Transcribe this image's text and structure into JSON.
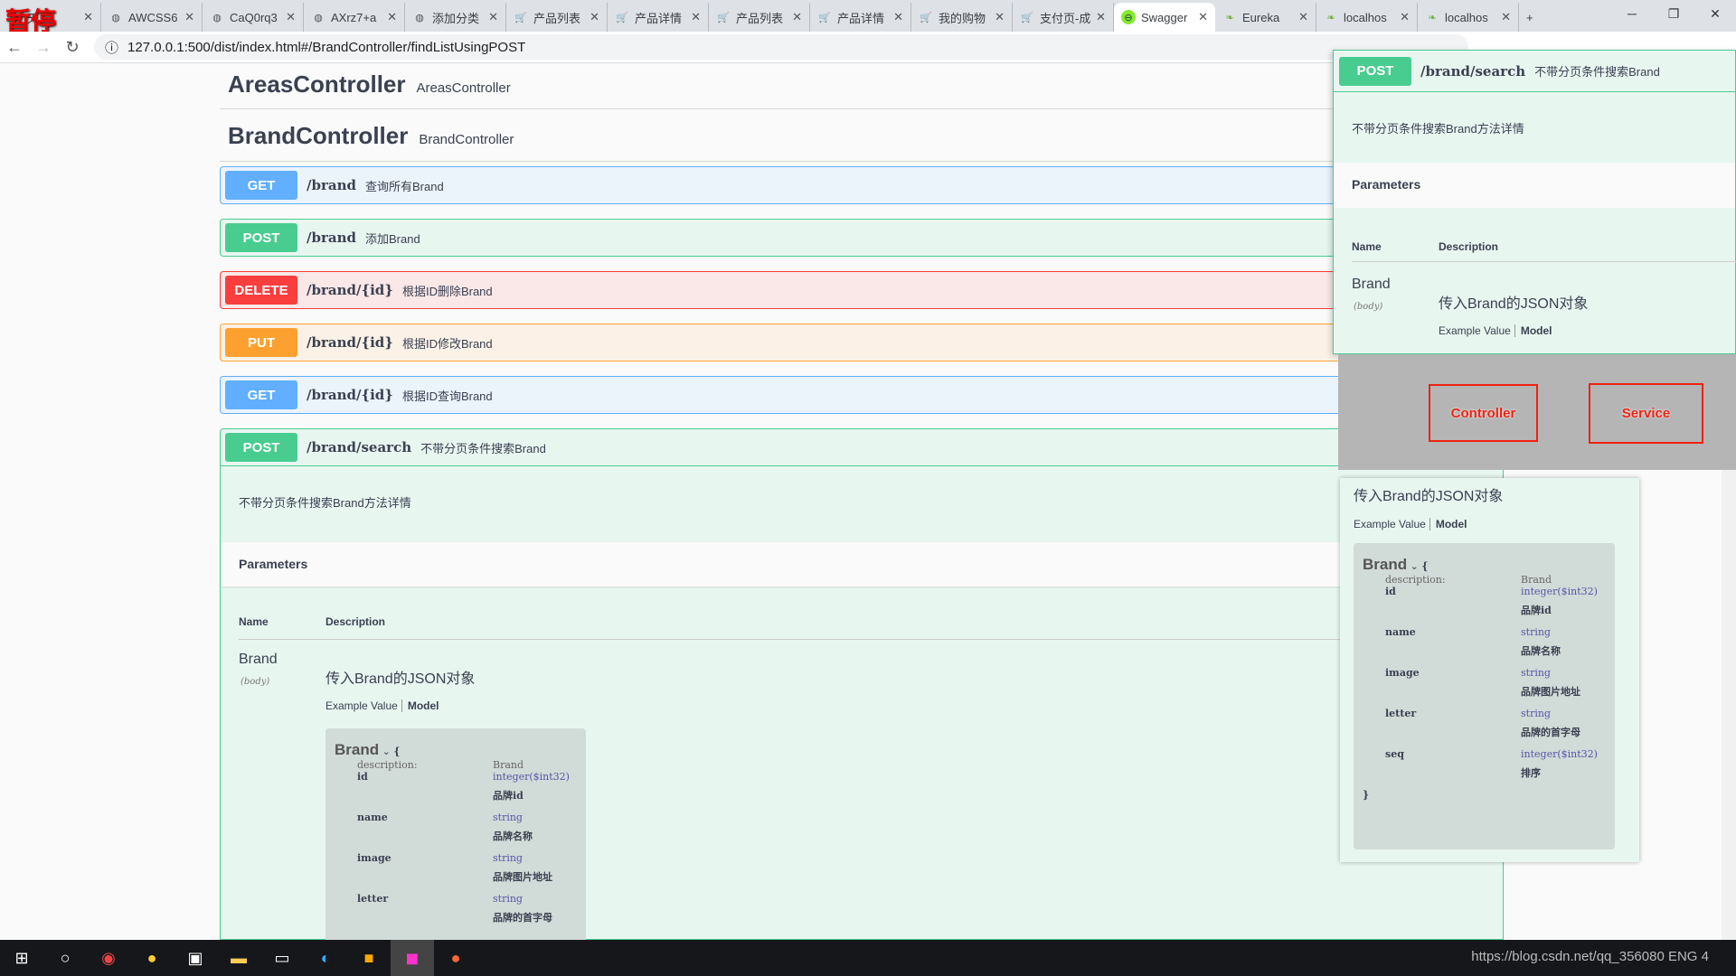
{
  "browser": {
    "overlay_label": "暂停",
    "tabs": [
      {
        "label": "天",
        "icon": "globe"
      },
      {
        "label": "AWCSS6",
        "icon": "globe"
      },
      {
        "label": "CaQ0rq3",
        "icon": "globe"
      },
      {
        "label": "AXrz7+a",
        "icon": "globe"
      },
      {
        "label": "添加分类",
        "icon": "globe"
      },
      {
        "label": "产品列表",
        "icon": "cart"
      },
      {
        "label": "产品详情",
        "icon": "cart"
      },
      {
        "label": "产品列表",
        "icon": "cart"
      },
      {
        "label": "产品详情",
        "icon": "cart"
      },
      {
        "label": "我的购物",
        "icon": "cart"
      },
      {
        "label": "支付页-成",
        "icon": "cart"
      },
      {
        "label": "Swagger",
        "icon": "swagger",
        "active": true
      },
      {
        "label": "Eureka",
        "icon": "spring"
      },
      {
        "label": "localhos",
        "icon": "spring"
      },
      {
        "label": "localhos",
        "icon": "spring"
      }
    ],
    "url": "127.0.0.1:500/dist/index.html#/BrandController/findListUsingPOST"
  },
  "swagger": {
    "tags": [
      {
        "name": "AreasController",
        "desc": "AreasController"
      },
      {
        "name": "BrandController",
        "desc": "BrandController"
      }
    ],
    "operations": [
      {
        "method": "GET",
        "path": "/brand",
        "summary": "查询所有Brand"
      },
      {
        "method": "POST",
        "path": "/brand",
        "summary": "添加Brand"
      },
      {
        "method": "DELETE",
        "path": "/brand/{id}",
        "summary": "根据ID删除Brand"
      },
      {
        "method": "PUT",
        "path": "/brand/{id}",
        "summary": "根据ID修改Brand"
      },
      {
        "method": "GET",
        "path": "/brand/{id}",
        "summary": "根据ID查询Brand"
      },
      {
        "method": "POST",
        "path": "/brand/search",
        "summary": "不带分页条件搜索Brand"
      }
    ],
    "expanded": {
      "description": "不带分页条件搜索Brand方法详情",
      "parameters_title": "Parameters",
      "col_name": "Name",
      "col_desc": "Description",
      "param_name": "Brand",
      "param_in": "(body)",
      "param_desc": "传入Brand的JSON对象",
      "example_value": "Example Value",
      "model": "Model",
      "model_name": "Brand",
      "open_brace": "{",
      "close_brace": "}",
      "model_desc_label": "description:",
      "model_desc": "Brand",
      "fields": [
        {
          "name": "id",
          "type": "integer($int32)",
          "desc": "品牌id"
        },
        {
          "name": "name",
          "type": "string",
          "desc": "品牌名称"
        },
        {
          "name": "image",
          "type": "string",
          "desc": "品牌图片地址"
        },
        {
          "name": "letter",
          "type": "string",
          "desc": "品牌的首字母"
        },
        {
          "name": "seq",
          "type": "integer($int32)",
          "desc": "排序"
        }
      ]
    }
  },
  "annotations": {
    "controller": "Controller",
    "service": "Service"
  },
  "taskbar": {
    "tray_text": "https://blog.csdn.net/qq_356080",
    "lang": "ENG",
    "notifications": "4"
  }
}
